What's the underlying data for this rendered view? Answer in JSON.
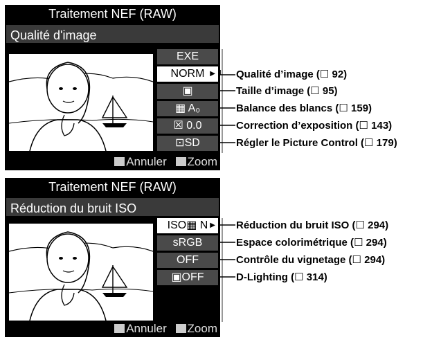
{
  "screen1": {
    "title": "Traitement NEF (RAW)",
    "subtitle": "Qualité d'image",
    "items": [
      {
        "label": "EXE"
      },
      {
        "label": "NORM",
        "arrow": "▶"
      },
      {
        "label": "▣"
      },
      {
        "label": "▦ A₀"
      },
      {
        "label": "☒ 0.0"
      },
      {
        "label": "⊡SD"
      }
    ],
    "footer_cancel": "Annuler",
    "footer_zoom": "Zoom"
  },
  "screen2": {
    "title": "Traitement NEF (RAW)",
    "subtitle": "Réduction du bruit ISO",
    "items": [
      {
        "label": "ISO▦ N",
        "arrow": "▶"
      },
      {
        "label": "sRGB"
      },
      {
        "label": "OFF"
      },
      {
        "label": "▣OFF"
      }
    ],
    "footer_cancel": "Annuler",
    "footer_zoom": "Zoom"
  },
  "callouts1": [
    {
      "text": "Qualité d’image (",
      "book": "☐",
      "page": " 92)"
    },
    {
      "text": "Taille d’image (",
      "book": "☐",
      "page": " 95)"
    },
    {
      "text": "Balance des blancs (",
      "book": "☐",
      "page": " 159)"
    },
    {
      "text": "Correction d’exposition (",
      "book": "☐",
      "page": " 143)"
    },
    {
      "text": "Régler le Picture Control (",
      "book": "☐",
      "page": " 179)"
    }
  ],
  "callouts2": [
    {
      "text": "Réduction du bruit ISO (",
      "book": "☐",
      "page": " 294)"
    },
    {
      "text": "Espace colorimétrique (",
      "book": "☐",
      "page": " 294)"
    },
    {
      "text": "Contrôle du vignetage (",
      "book": "☐",
      "page": " 294)"
    },
    {
      "text": "D-Lighting (",
      "book": "☐",
      "page": " 314)"
    }
  ]
}
